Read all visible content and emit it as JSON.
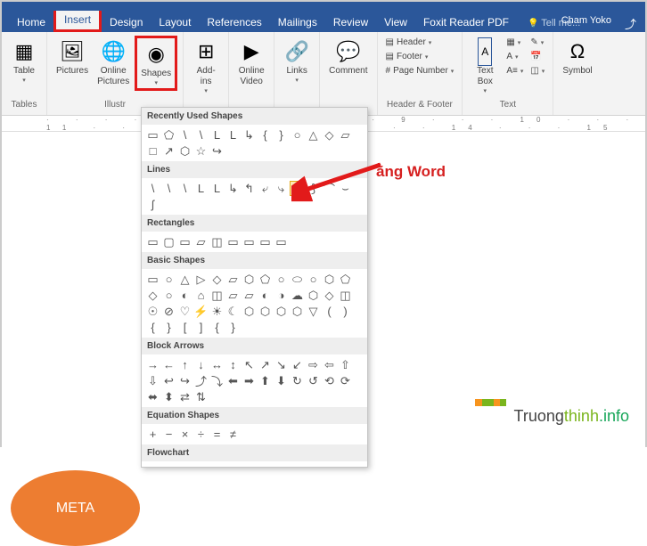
{
  "title_bar": {
    "user_name": "Cham Yoko"
  },
  "tabs": {
    "items": [
      "Home",
      "Insert",
      "Design",
      "Layout",
      "References",
      "Mailings",
      "Review",
      "View",
      "Foxit Reader PDF"
    ],
    "active_index": 1,
    "tell_me": "Tell me..."
  },
  "ribbon": {
    "tables": {
      "label": "Tables",
      "table": "Table"
    },
    "illustrations": {
      "label": "Illustr",
      "pictures": "Pictures",
      "online_pictures": "Online\nPictures",
      "shapes": "Shapes"
    },
    "addins": {
      "label": "Add-\nins"
    },
    "media": {
      "online_video": "Online\nVideo"
    },
    "links": {
      "label": "Links"
    },
    "comments": {
      "label": "Comment"
    },
    "header_footer": {
      "label": "Header & Footer",
      "header": "Header",
      "footer": "Footer",
      "page_number": "Page Number"
    },
    "text": {
      "label": "Text",
      "text_box": "Text\nBox"
    },
    "symbols": {
      "symbol": "Symbol"
    }
  },
  "ruler": "· · · · 7 · · · 8 · · · 9 · · · 10 · · · 11 · · · 12 · · · 13 · · · 14 · · · 15 · · · 16 ·",
  "document": {
    "visible_text": "ằng Word",
    "meta": "META"
  },
  "shapes_dropdown": {
    "sections": [
      {
        "title": "Recently Used Shapes",
        "shapes": [
          "▭",
          "⬠",
          "\\",
          "\\",
          "L",
          "L",
          "↳",
          "{",
          "}",
          "○",
          "△",
          "◇",
          "▱",
          "□",
          "↗",
          "⬡",
          "☆",
          "↪"
        ]
      },
      {
        "title": "Lines",
        "shapes": [
          "\\",
          "\\",
          "\\",
          "L",
          "L",
          "↳",
          "↰",
          "⤶",
          "⤷",
          "ᔕ",
          "⟆",
          "⌒",
          "⌣",
          "ʃ"
        ]
      },
      {
        "title": "Rectangles",
        "shapes": [
          "▭",
          "▢",
          "▭",
          "▱",
          "◫",
          "▭",
          "▭",
          "▭",
          "▭"
        ]
      },
      {
        "title": "Basic Shapes",
        "shapes": [
          "▭",
          "○",
          "△",
          "▷",
          "◇",
          "▱",
          "⬡",
          "⬠",
          "○",
          "⬭",
          "○",
          "⬡",
          "⬠",
          "◇",
          "○",
          "◐",
          "⌂",
          "◫",
          "▱",
          "▱",
          "◐",
          "◑",
          "☁",
          "⬡",
          "◇",
          "◫",
          "☉",
          "⊘",
          "♡",
          "⚡",
          "☀",
          "☾",
          "⬡",
          "⬡",
          "⬡",
          "⬡",
          "▽",
          "(",
          ")",
          "{",
          "}",
          "[",
          "]",
          "{",
          "}"
        ]
      },
      {
        "title": "Block Arrows",
        "shapes": [
          "→",
          "←",
          "↑",
          "↓",
          "↔",
          "↕",
          "↖",
          "↗",
          "↘",
          "↙",
          "⇨",
          "⇦",
          "⇧",
          "⇩",
          "↩",
          "↪",
          "⤴",
          "⤵",
          "⬅",
          "➡",
          "⬆",
          "⬇",
          "↻",
          "↺",
          "⟲",
          "⟳",
          "⬌",
          "⬍",
          "⇄",
          "⇅"
        ]
      },
      {
        "title": "Equation Shapes",
        "shapes": [
          "+",
          "−",
          "×",
          "÷",
          "=",
          "≠"
        ]
      },
      {
        "title": "Flowchart",
        "shapes": []
      }
    ]
  },
  "watermark": {
    "text_1": "Truong",
    "text_2": "thinh",
    "text_3": ".info"
  }
}
